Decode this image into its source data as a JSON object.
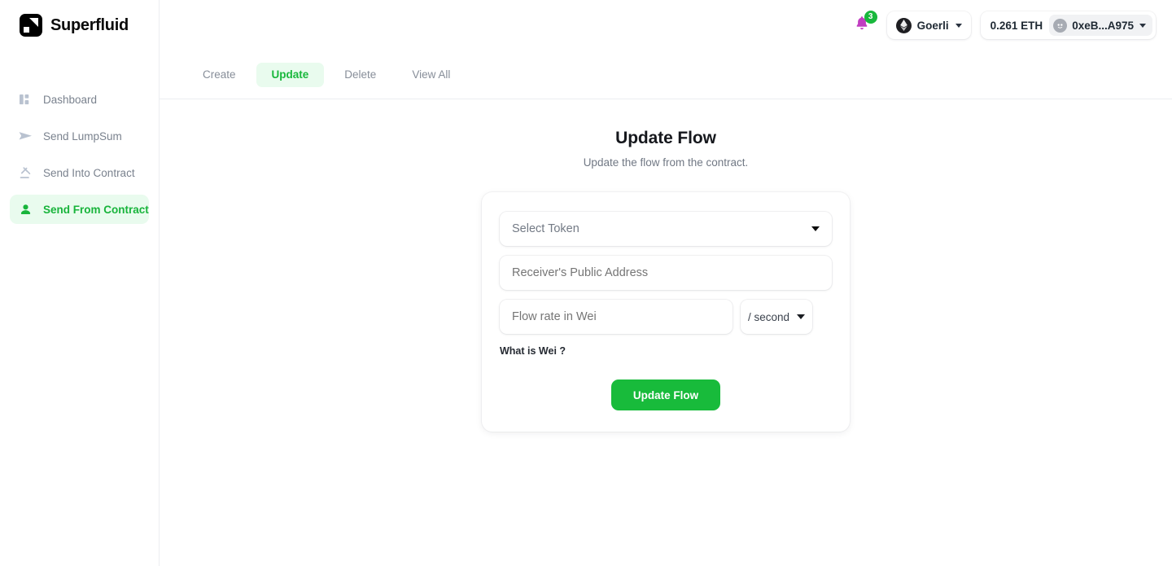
{
  "brand": {
    "name": "Superfluid",
    "logo_icon": "superfluid-logo-icon"
  },
  "sidebar": {
    "items": [
      {
        "label": "Dashboard",
        "icon": "dashboard-grid-icon",
        "active": false
      },
      {
        "label": "Send LumpSum",
        "icon": "paper-plane-icon",
        "active": false
      },
      {
        "label": "Send Into Contract",
        "icon": "gavel-icon",
        "active": false
      },
      {
        "label": "Send From Contract",
        "icon": "person-icon",
        "active": true
      }
    ]
  },
  "topbar": {
    "notifications": {
      "icon": "bell-icon",
      "count": "3"
    },
    "network": {
      "icon": "ethereum-icon",
      "label": "Goerli",
      "chevron": "chevron-down-icon"
    },
    "wallet": {
      "balance": "0.261 ETH",
      "avatar_icon": "wallet-avatar-icon",
      "address": "0xeB...A975",
      "chevron": "chevron-down-icon"
    }
  },
  "tabs": [
    {
      "label": "Create",
      "active": false
    },
    {
      "label": "Update",
      "active": true
    },
    {
      "label": "Delete",
      "active": false
    },
    {
      "label": "View All",
      "active": false
    }
  ],
  "page": {
    "title": "Update Flow",
    "subtitle": "Update the flow from the contract."
  },
  "form": {
    "token_select": {
      "placeholder": "Select Token",
      "caret_icon": "dropdown-caret-icon"
    },
    "receiver": {
      "placeholder": "Receiver's Public Address",
      "value": ""
    },
    "flow_rate": {
      "placeholder": "Flow rate in Wei",
      "value": ""
    },
    "rate_unit": {
      "label": "/ second",
      "caret_icon": "dropdown-caret-icon"
    },
    "wei_help_link": "What is Wei ?",
    "submit_label": "Update Flow"
  },
  "colors": {
    "accent_green": "#18bb3b",
    "accent_green_soft": "#e9fbee",
    "text_muted": "#737a85",
    "badge_green": "#19b83c",
    "bell_purple": "#c13ec1"
  }
}
